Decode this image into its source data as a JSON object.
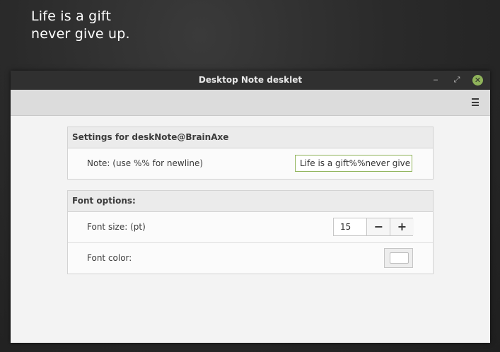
{
  "desklet": {
    "lines": [
      "Life is a gift",
      "never give up."
    ]
  },
  "window": {
    "title": "Desktop Note desklet",
    "controls": {
      "minimize": "‒",
      "maximize": "⤢",
      "close": "✕"
    },
    "menu_icon": "hamburger-menu-icon"
  },
  "settings": {
    "section1": {
      "header": "Settings for deskNote@BrainAxe",
      "note": {
        "label": "Note: (use %% for newline)",
        "value": "Life is a gift%%never give up."
      }
    },
    "section2": {
      "header": "Font options:",
      "font_size": {
        "label": "Font size: (pt)",
        "value": "15",
        "minus": "−",
        "plus": "+"
      },
      "font_color": {
        "label": "Font color:",
        "value": "#ffffff"
      }
    }
  },
  "colors": {
    "accent": "#8fb35a",
    "titlebar": "#303030"
  }
}
